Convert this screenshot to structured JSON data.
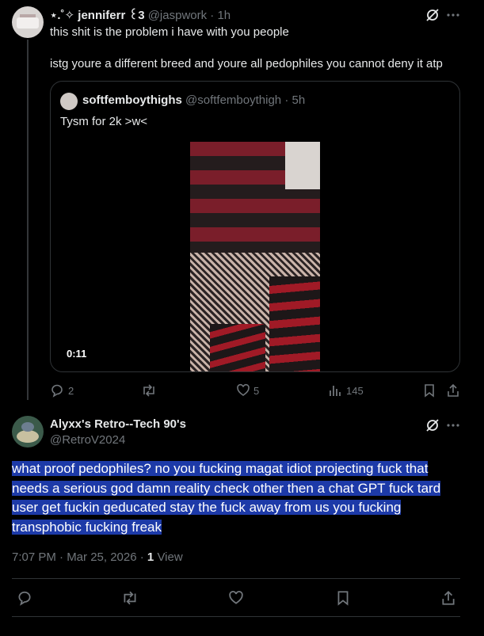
{
  "parent_tweet": {
    "display_name": "⋆.˚✧ jenniferr ꒰3",
    "handle": "@jaspwork",
    "time": "· 1h",
    "line1": "this shit is the problem i have with you people",
    "line2": "istg youre a different breed and youre all pedophiles you cannot deny it atp",
    "quoted": {
      "display_name": "softfemboythighs",
      "handle": "@softfemboythigh",
      "time": "· 5h",
      "text": "Tysm for 2k >w<",
      "video_time": "0:11"
    },
    "actions": {
      "replies": "2",
      "likes": "5",
      "views": "145"
    }
  },
  "reply_tweet": {
    "display_name": "Alyxx's Retro--Tech 90's",
    "handle": "@RetroV2024",
    "text_lines": [
      "what proof pedophiles? no you fucking magat idiot projecting fuck that",
      "needs a serious god damn reality check other then a chat GPT fuck tard",
      "user get fuckin geducated stay the fuck away from us you fucking",
      "transphobic fucking freak"
    ],
    "timestamp": "7:07 PM · Mar 25, 2026 ·",
    "views_count": "1",
    "views_label": "View"
  },
  "icons": [
    "grok-icon",
    "more-icon",
    "reply-icon",
    "retweet-icon",
    "like-icon",
    "views-icon",
    "bookmark-icon",
    "share-icon"
  ],
  "colors": {
    "background": "#000000",
    "text": "#e7e9ea",
    "muted": "#71767b",
    "border": "#2f3336",
    "selection": "#1d3aa8"
  }
}
